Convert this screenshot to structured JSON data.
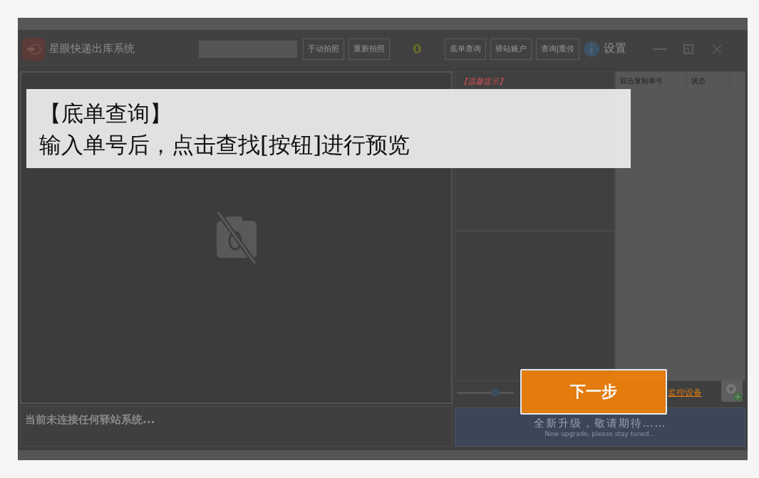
{
  "app": {
    "title": "星眼快递出库系统",
    "capture_buttons": [
      "手动拍照",
      "重新拍照"
    ],
    "count": "0",
    "nav_buttons": [
      "底单查询",
      "驿站账户",
      "查询|重传"
    ],
    "settings": "设置"
  },
  "notice": {
    "heading": "【温馨提示】"
  },
  "list": {
    "columns": [
      "双击复制单号",
      "状态"
    ]
  },
  "slider": {
    "level": 0.68
  },
  "monitor_link": "监控设备",
  "status": "当前未连接任何驿站系统...",
  "banner": {
    "title": "全新升级，敬请期待……",
    "subtitle": "New upgrade, please stay tuned..."
  },
  "guide": {
    "title": "【底单查询】",
    "text": "输入单号后，点击查找[按钮]进行预览",
    "next_button": "下一步"
  }
}
